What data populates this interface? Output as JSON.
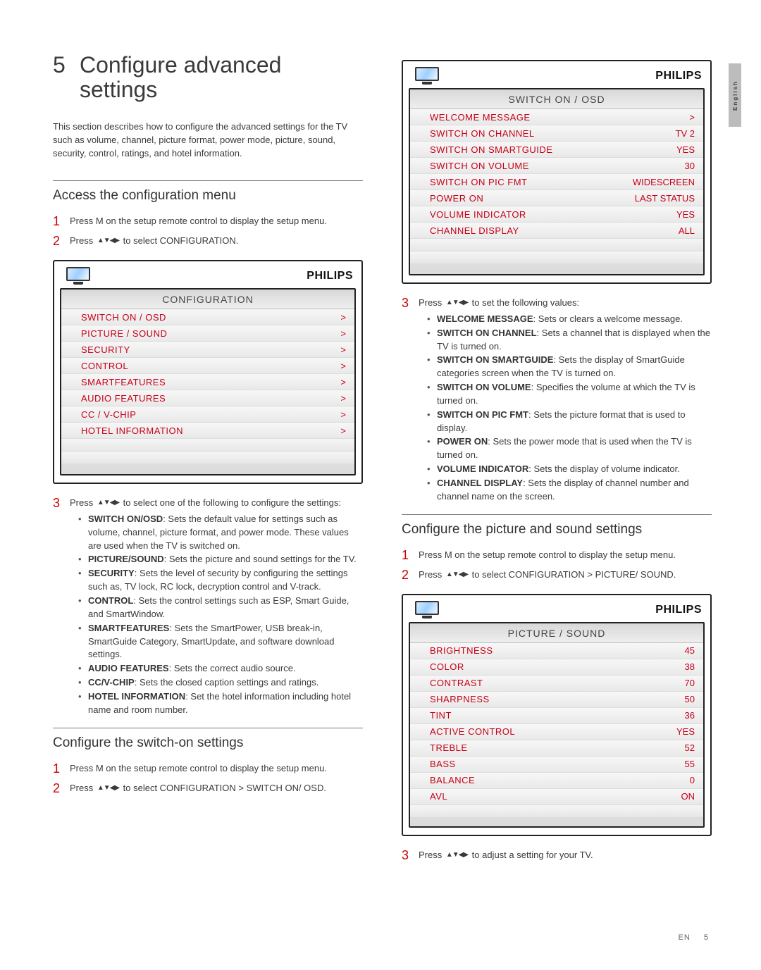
{
  "lang_tab": "English",
  "chapter": {
    "number": "5",
    "title_line1": "Configure advanced",
    "title_line2": "settings"
  },
  "intro": "This section describes how to configure the advanced settings for the TV such as volume, channel, picture format, power mode, picture, sound, security, control, ratings, and hotel information.",
  "section_access": "Access the configuration menu",
  "access_steps": {
    "s1": "Press M on the setup remote control to display the setup menu.",
    "s2_pre": "Press ",
    "s2_post": " to select CONFIGURATION."
  },
  "arrows_glyph": "▲▼◀▶",
  "osd_brand": "PHILIPS",
  "osd_config": {
    "title": "CONFIGURATION",
    "rows": [
      {
        "label": "SWITCH ON / OSD",
        "value": ">"
      },
      {
        "label": "PICTURE / SOUND",
        "value": ">"
      },
      {
        "label": "SECURITY",
        "value": ">"
      },
      {
        "label": "CONTROL",
        "value": ">"
      },
      {
        "label": "SMARTFEATURES",
        "value": ">"
      },
      {
        "label": "AUDIO FEATURES",
        "value": ">"
      },
      {
        "label": "CC / V-CHIP",
        "value": ">"
      },
      {
        "label": "HOTEL INFORMATION",
        "value": ">"
      }
    ]
  },
  "config_step3_intro_pre": "Press ",
  "config_step3_intro_post": " to select one of the following to configure the settings:",
  "config_bullets": [
    {
      "b": "SWITCH ON/OSD",
      "t": ": Sets the default value for settings such as volume, channel, picture format, and power mode. These values are used when the TV is switched on."
    },
    {
      "b": "PICTURE/SOUND",
      "t": ": Sets the picture and sound settings for the TV."
    },
    {
      "b": "SECURITY",
      "t": ": Sets the level of security by configuring the settings such as, TV lock, RC lock, decryption control and V-track."
    },
    {
      "b": "CONTROL",
      "t": ": Sets the control settings such as ESP, Smart Guide, and SmartWindow."
    },
    {
      "b": "SMARTFEATURES",
      "t": ": Sets the SmartPower, USB break-in, SmartGuide Category, SmartUpdate, and software download settings."
    },
    {
      "b": "AUDIO FEATURES",
      "t": ": Sets the correct audio source."
    },
    {
      "b": "CC/V-CHIP",
      "t": ": Sets the closed caption settings and ratings."
    },
    {
      "b": "HOTEL INFORMATION",
      "t": ": Set the hotel information including hotel name and room number."
    }
  ],
  "section_switchon": "Configure the switch-on settings",
  "switchon_steps": {
    "s1": "Press M on the setup remote control to display the setup menu.",
    "s2_pre": "Press ",
    "s2_post": " to select CONFIGURATION > SWITCH ON/ OSD."
  },
  "osd_switchon": {
    "title": "SWITCH ON / OSD",
    "rows": [
      {
        "label": "WELCOME MESSAGE",
        "value": ">"
      },
      {
        "label": "SWITCH ON CHANNEL",
        "value": "TV 2"
      },
      {
        "label": "SWITCH ON SMARTGUIDE",
        "value": "YES"
      },
      {
        "label": "SWITCH ON VOLUME",
        "value": "30"
      },
      {
        "label": "SWITCH ON PIC FMT",
        "value": "WIDESCREEN"
      },
      {
        "label": "POWER ON",
        "value": "LAST STATUS"
      },
      {
        "label": "VOLUME INDICATOR",
        "value": "YES"
      },
      {
        "label": "CHANNEL DISPLAY",
        "value": "ALL"
      }
    ]
  },
  "switchon_step3_intro_pre": "Press ",
  "switchon_step3_intro_post": " to set the following values:",
  "switchon_bullets": [
    {
      "b": "WELCOME MESSAGE",
      "t": ": Sets or clears a welcome message."
    },
    {
      "b": "SWITCH ON CHANNEL",
      "t": ": Sets a channel that is displayed when the TV is turned on."
    },
    {
      "b": "SWITCH ON SMARTGUIDE",
      "t": ": Sets the display of SmartGuide categories screen when the TV is turned on."
    },
    {
      "b": "SWITCH ON VOLUME",
      "t": ": Specifies the volume at which the TV is turned on."
    },
    {
      "b": "SWITCH ON PIC FMT",
      "t": ": Sets the picture format that is used to display."
    },
    {
      "b": "POWER ON",
      "t": ": Sets the power mode that is used when the TV is turned on."
    },
    {
      "b": "VOLUME INDICATOR",
      "t": ": Sets the display of volume indicator."
    },
    {
      "b": "CHANNEL DISPLAY",
      "t": ": Sets the display of channel number and channel name on the screen."
    }
  ],
  "section_picsound": "Configure the picture and sound settings",
  "picsound_steps": {
    "s1": "Press M on the setup remote control to display the setup menu.",
    "s2_pre": "Press ",
    "s2_post": " to select CONFIGURATION > PICTURE/ SOUND."
  },
  "osd_picsound": {
    "title": "PICTURE / SOUND",
    "rows": [
      {
        "label": "BRIGHTNESS",
        "value": "45"
      },
      {
        "label": "COLOR",
        "value": "38"
      },
      {
        "label": "CONTRAST",
        "value": "70"
      },
      {
        "label": "SHARPNESS",
        "value": "50"
      },
      {
        "label": "TINT",
        "value": "36"
      },
      {
        "label": "ACTIVE CONTROL",
        "value": "YES"
      },
      {
        "label": "TREBLE",
        "value": "52"
      },
      {
        "label": "BASS",
        "value": "55"
      },
      {
        "label": "BALANCE",
        "value": "0"
      },
      {
        "label": "AVL",
        "value": "ON"
      }
    ]
  },
  "picsound_step3_pre": "Press ",
  "picsound_step3_post": " to adjust a setting for your TV.",
  "footer": {
    "lang": "EN",
    "page": "5"
  }
}
